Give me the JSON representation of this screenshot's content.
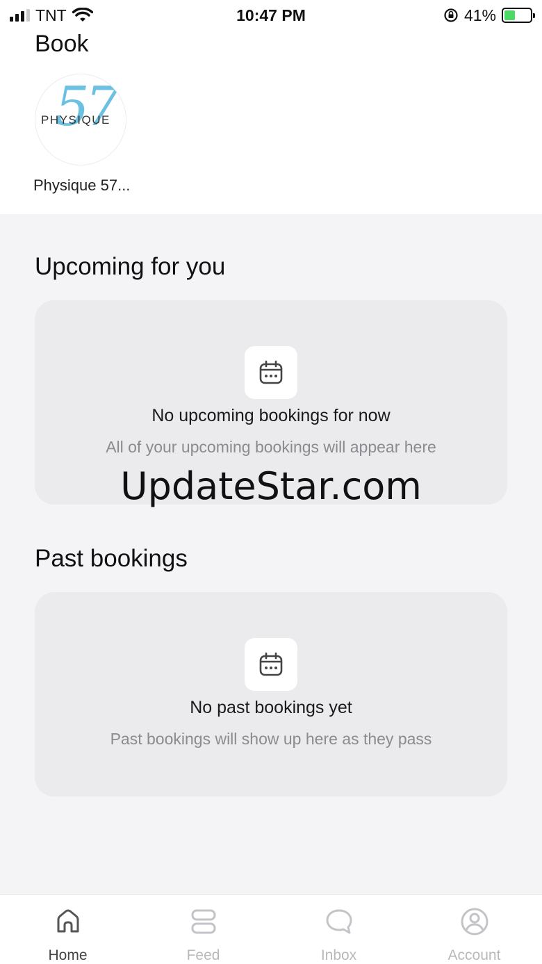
{
  "status_bar": {
    "carrier": "TNT",
    "time": "10:47 PM",
    "battery_percent": "41%",
    "battery_level": 0.41,
    "icons": [
      "signal-icon",
      "wifi-icon",
      "orientation-lock-icon",
      "battery-charging-icon"
    ]
  },
  "header": {
    "title": "Book"
  },
  "studio": {
    "name": "Physique 57...",
    "logo_text": "PHYSIQUE",
    "logo_number": "57"
  },
  "upcoming": {
    "title": "Upcoming for you",
    "empty_title": "No upcoming bookings for now",
    "empty_subtitle": "All of your upcoming bookings will appear here",
    "icon": "calendar-icon"
  },
  "past": {
    "title": "Past bookings",
    "empty_title": "No past bookings yet",
    "empty_subtitle": "Past bookings will show up here as they pass",
    "icon": "calendar-icon"
  },
  "watermark": "UpdateStar.com",
  "tabs": [
    {
      "label": "Home",
      "icon": "home-icon",
      "active": true
    },
    {
      "label": "Feed",
      "icon": "feed-icon",
      "active": false
    },
    {
      "label": "Inbox",
      "icon": "chat-bubble-icon",
      "active": false
    },
    {
      "label": "Account",
      "icon": "user-icon",
      "active": false
    }
  ],
  "colors": {
    "background": "#f4f4f6",
    "card": "#ebebed",
    "accent_logo": "#6cc1e3",
    "battery_green": "#4cd964",
    "inactive_tab": "#b9b9bd"
  }
}
